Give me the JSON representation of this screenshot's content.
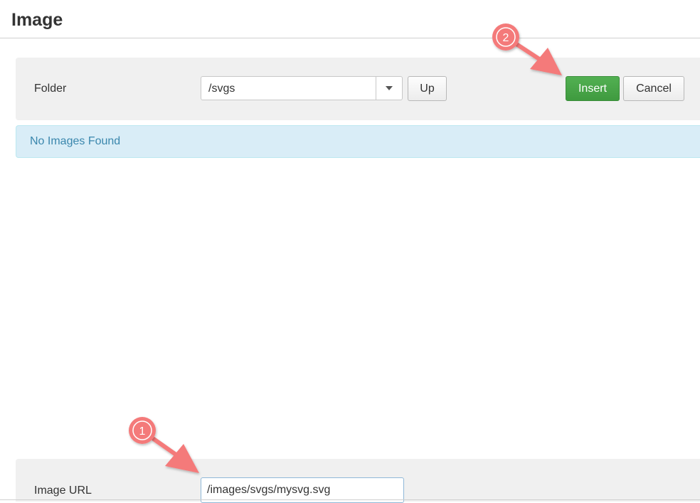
{
  "modal": {
    "title": "Image"
  },
  "toolbar": {
    "folder_label": "Folder",
    "folder_value": "/svgs",
    "up_label": "Up",
    "insert_label": "Insert",
    "cancel_label": "Cancel"
  },
  "alert": {
    "message": "No Images Found"
  },
  "fields": {
    "image_url_label": "Image URL",
    "image_url_value": "/images/svgs/mysvg.svg"
  },
  "annotations": {
    "step1": "1",
    "step2": "2",
    "color": "#f47a7a"
  },
  "colors": {
    "insert_button": "#46a546",
    "alert_bg": "#d9edf7",
    "alert_text": "#3a87ad",
    "panel_bg": "#f0f0f0"
  }
}
